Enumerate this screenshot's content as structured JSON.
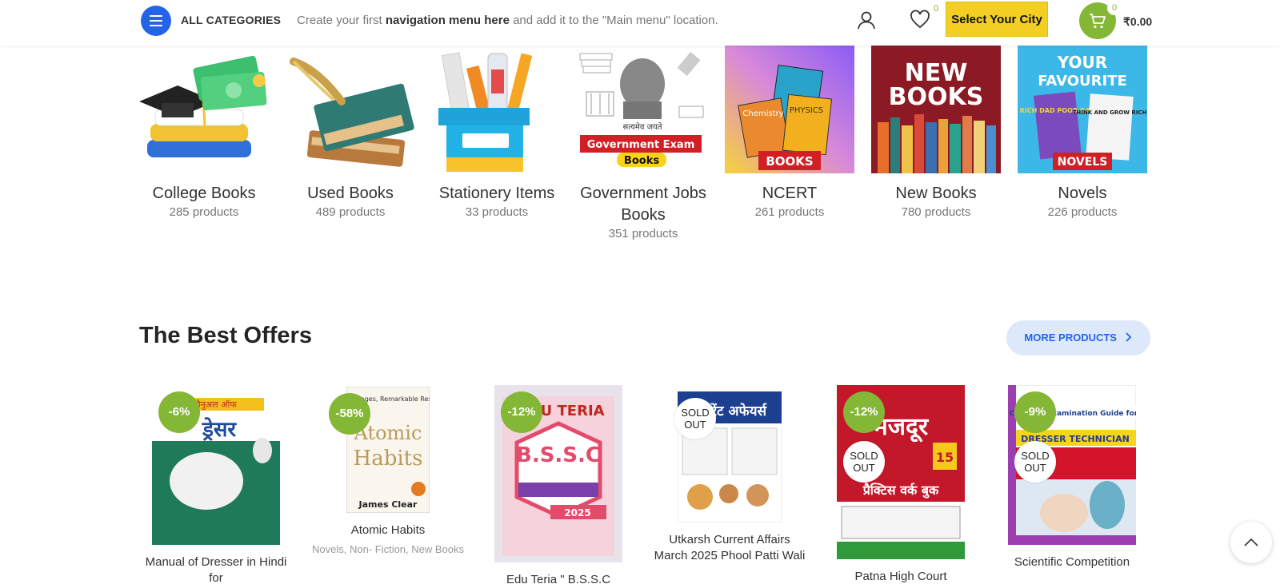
{
  "header": {
    "all_categories": "ALL CATEGORIES",
    "nav_message_pre": "Create your first ",
    "nav_message_bold": "navigation menu here",
    "nav_message_post": " and add it to the \"Main menu\" location.",
    "wishlist_count": "0",
    "city_button": "Select Your City",
    "cart_count": "0",
    "cart_total": "₹0.00"
  },
  "categories": [
    {
      "name": "College Books",
      "count": "285 products"
    },
    {
      "name": "Used Books",
      "count": "489 products"
    },
    {
      "name": "Stationery Items",
      "count": "33 products"
    },
    {
      "name": "Government Jobs Books",
      "count": "351 products"
    },
    {
      "name": "NCERT",
      "count": "261 products"
    },
    {
      "name": "New Books",
      "count": "780 products"
    },
    {
      "name": "Novels",
      "count": "226 products"
    }
  ],
  "category_image_text": {
    "gov_banner": "Government Exam",
    "gov_books": "Books",
    "gov_motto": "सत्यमेव जयते",
    "ncert_label": "BOOKS",
    "ncert_chem": "Chemistry",
    "ncert_phys": "PHYSICS",
    "new_books_1": "NEW",
    "new_books_2": "BOOKS",
    "novels_1": "YOUR",
    "novels_2": "FAVOURITE",
    "novels_3": "NOVELS",
    "novels_book1": "RICH DAD POOR DAD",
    "novels_book2": "THINK AND GROW RICH"
  },
  "section": {
    "title": "The Best Offers",
    "more_button": "MORE PRODUCTS"
  },
  "products": [
    {
      "badge": "-6%",
      "sold_out": "",
      "name": "Manual of Dresser in Hindi for",
      "cats": "",
      "cover_top": "मैनुअल ऑफ",
      "cover_main": "ड्रेसर"
    },
    {
      "badge": "-58%",
      "sold_out": "",
      "name": "Atomic Habits",
      "cats": "Novels, Non- Fiction, New Books",
      "cover_top": "Tiny Changes, Remarkable Results",
      "cover_main": "Atomic Habits",
      "cover_author": "James Clear"
    },
    {
      "badge": "-12%",
      "sold_out": "",
      "name": "Edu Teria \" B.S.S.C",
      "cats": "",
      "cover_top": "EDU TERIA",
      "cover_main": "B.S.S.C",
      "cover_year": "2025"
    },
    {
      "badge": "",
      "sold_out": "SOLD OUT",
      "name": "Utkarsh Current Affairs March 2025 Phool Patti Wali",
      "cats": "",
      "cover_main": "करेंट अफेयर्स"
    },
    {
      "badge": "-12%",
      "sold_out": "SOLD OUT",
      "name": "Patna High Court",
      "cats": "",
      "cover_main": "मजदूर",
      "cover_sub": "प्रैक्टिस वर्क बुक",
      "cover_num": "15"
    },
    {
      "badge": "-9%",
      "sold_out": "SOLD OUT",
      "name": "Scientific Competition",
      "cats": "",
      "cover_top": "Common Examination Guide for",
      "cover_main": "DRESSER TECHNICIAN"
    }
  ]
}
